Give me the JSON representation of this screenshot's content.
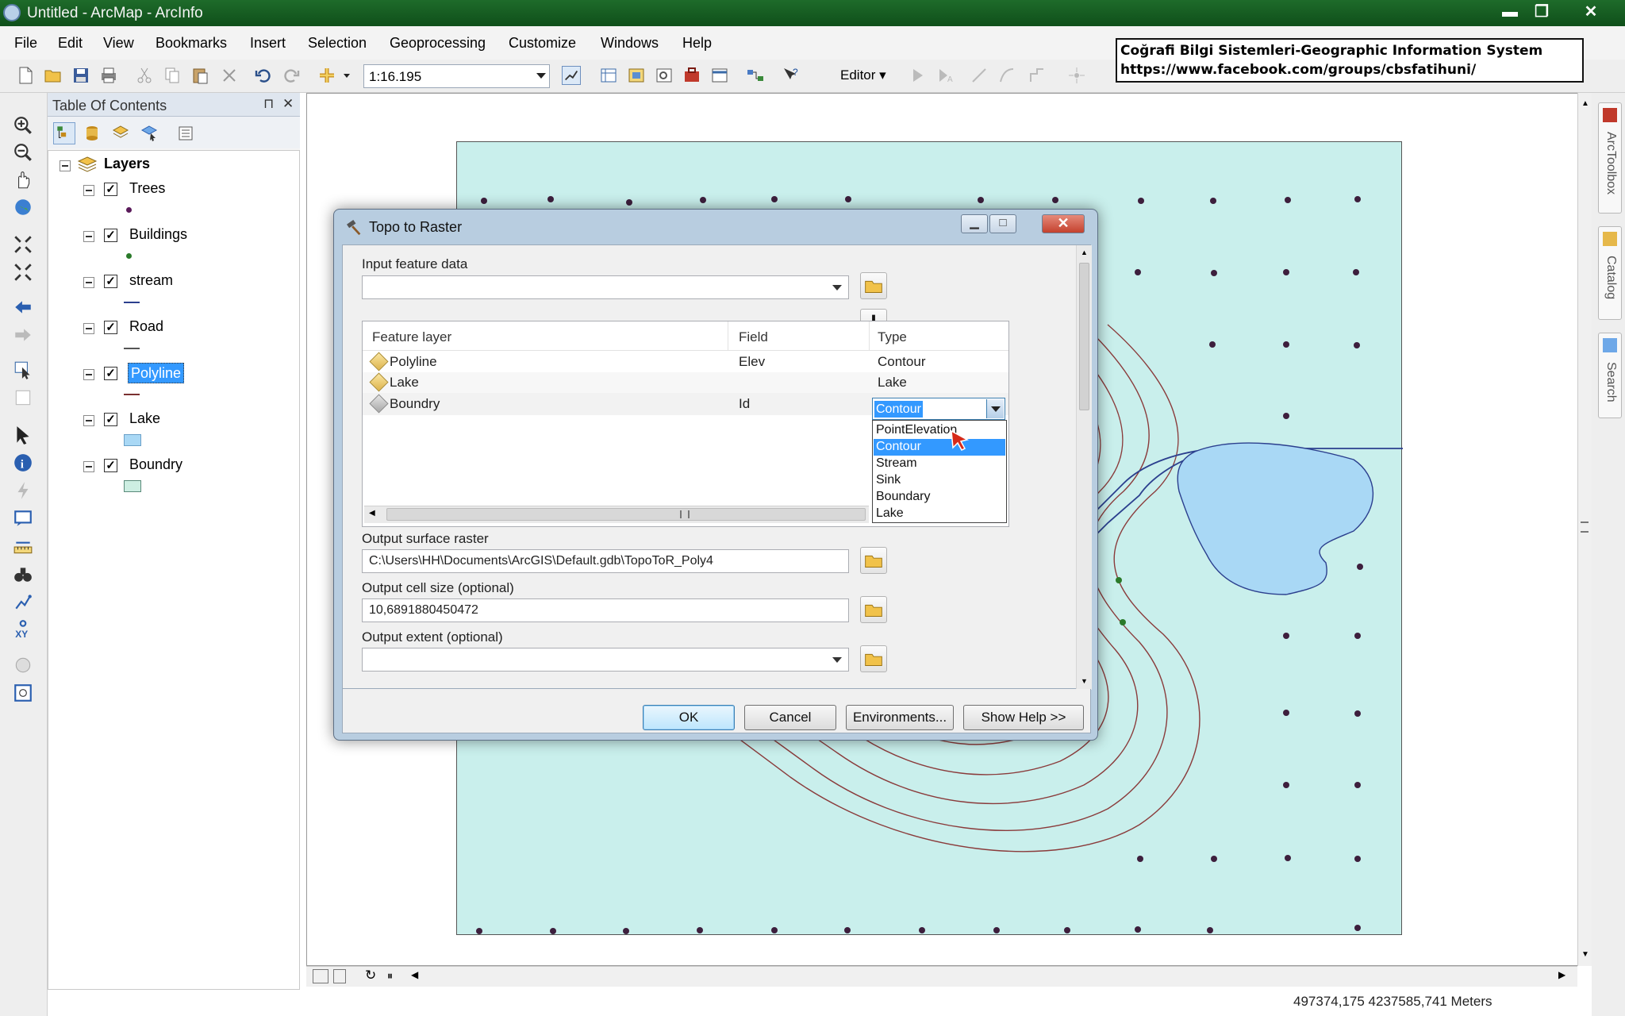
{
  "window": {
    "title": "Untitled - ArcMap - ArcInfo",
    "minimize": "▬",
    "restore": "❐",
    "close": "✕"
  },
  "menu": [
    "File",
    "Edit",
    "View",
    "Bookmarks",
    "Insert",
    "Selection",
    "Geoprocessing",
    "Customize",
    "Windows",
    "Help"
  ],
  "toolbar": {
    "scale": "1:16.195",
    "editor_label": "Editor ▾"
  },
  "banner": {
    "line1": "Coğrafi Bilgi Sistemleri-Geographic Information System",
    "line2": "https://www.facebook.com/groups/cbsfatihuni/"
  },
  "toc": {
    "title": "Table Of Contents",
    "pin": "⊓",
    "close": "✕",
    "root": "Layers",
    "layers": [
      {
        "name": "Trees",
        "checked": true
      },
      {
        "name": "Buildings",
        "checked": true
      },
      {
        "name": "stream",
        "checked": true
      },
      {
        "name": "Road",
        "checked": true
      },
      {
        "name": "Polyline",
        "checked": true
      },
      {
        "name": "Lake",
        "checked": true
      },
      {
        "name": "Boundry",
        "checked": true
      }
    ],
    "selected_layer": "Polyline"
  },
  "dialog": {
    "title": "Topo to Raster",
    "input_label": "Input feature data",
    "input_value": "",
    "columns": [
      "Feature layer",
      "Field",
      "Type"
    ],
    "rows": [
      {
        "layer": "Polyline",
        "field": "Elev",
        "type": "Contour"
      },
      {
        "layer": "Lake",
        "field": "",
        "type": "Lake"
      },
      {
        "layer": "Boundry",
        "field": "Id",
        "type": "Contour"
      }
    ],
    "type_options": [
      "PointElevation",
      "Contour",
      "Stream",
      "Sink",
      "Boundary",
      "Lake"
    ],
    "type_highlighted": "Contour",
    "output_raster_label": "Output surface raster",
    "output_raster_value": "C:\\Users\\HH\\Documents\\ArcGIS\\Default.gdb\\TopoToR_Poly4",
    "cell_size_label": "Output cell size (optional)",
    "cell_size_value": "10,6891880450472",
    "extent_label": "Output extent (optional)",
    "extent_value": "",
    "buttons": {
      "ok": "OK",
      "cancel": "Cancel",
      "env": "Environments...",
      "help": "Show Help >>"
    }
  },
  "dock": [
    "ArcToolbox",
    "Catalog",
    "Search"
  ],
  "status": {
    "coords": "497374,175  4237585,741 Meters"
  },
  "colors": {
    "map_bg": "#c9efec",
    "lake": "#a9d8f5",
    "contour": "#8a3b3b",
    "stream": "#2b3f8e",
    "point": "#3d1f3d"
  }
}
